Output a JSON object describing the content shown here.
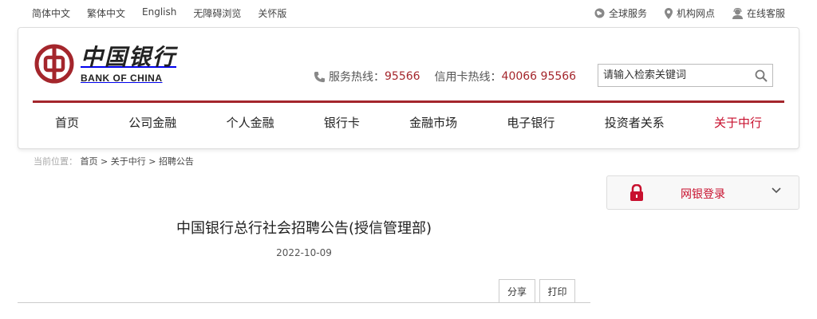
{
  "topbar": {
    "lang_links": [
      "简体中文",
      "繁体中文",
      "English",
      "无障碍浏览",
      "关怀版"
    ],
    "util_links": [
      {
        "label": "全球服务",
        "icon": "globe-icon"
      },
      {
        "label": "机构网点",
        "icon": "location-pin-icon"
      },
      {
        "label": "在线客服",
        "icon": "customer-service-icon"
      }
    ]
  },
  "header": {
    "logo_cn": "中国银行",
    "logo_en": "BANK OF CHINA",
    "service_hotline_label": "服务热线：",
    "service_hotline_number": "95566",
    "card_hotline_label": "信用卡热线：",
    "card_hotline_number": "40066 95566",
    "search_placeholder": "请输入检索关键词"
  },
  "nav": {
    "items": [
      "首页",
      "公司金融",
      "个人金融",
      "银行卡",
      "金融市场",
      "电子银行",
      "投资者关系",
      "关于中行"
    ],
    "active_index": 7
  },
  "breadcrumb": {
    "lead": "当前位置：",
    "path": [
      "首页",
      "关于中行",
      "招聘公告"
    ],
    "separator": " > "
  },
  "login_panel": {
    "label": "网银登录"
  },
  "article": {
    "title": "中国银行总行社会招聘公告(授信管理部)",
    "date": "2022-10-09",
    "share_label": "分享",
    "print_label": "打印"
  },
  "colors": {
    "brand_red": "#a4262c",
    "active_red": "#c8102e"
  }
}
